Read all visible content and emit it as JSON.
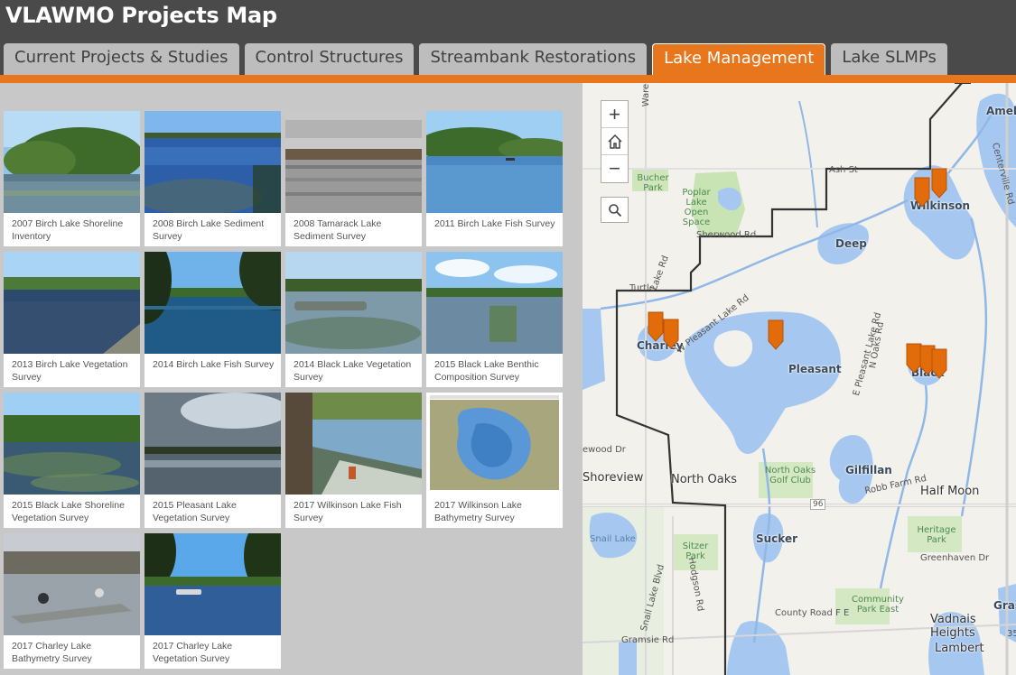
{
  "app": {
    "title": "VLAWMO Projects Map"
  },
  "tabs": [
    {
      "label": "Current Projects & Studies",
      "active": false
    },
    {
      "label": "Control Structures",
      "active": false
    },
    {
      "label": "Streambank Restorations",
      "active": false
    },
    {
      "label": "Lake Management",
      "active": true
    },
    {
      "label": "Lake SLMPs",
      "active": false
    }
  ],
  "colors": {
    "accent": "#e8761c",
    "header": "#4a4a4a",
    "lake": "#a6c8f0",
    "pin": "#e36c0a"
  },
  "gallery": {
    "items": [
      {
        "caption": "2007 Birch Lake Shoreline Inventory"
      },
      {
        "caption": "2008 Birch Lake Sediment Survey"
      },
      {
        "caption": "2008 Tamarack Lake Sediment Survey"
      },
      {
        "caption": "2011 Birch Lake Fish Survey"
      },
      {
        "caption": "2013 Birch Lake Vegetation Survey"
      },
      {
        "caption": "2014 Birch Lake Fish Survey"
      },
      {
        "caption": "2014 Black Lake Vegetation Survey"
      },
      {
        "caption": "2015 Black Lake Benthic Composition Survey"
      },
      {
        "caption": "2015 Black Lake Shoreline Vegetation Survey"
      },
      {
        "caption": "2015 Pleasant Lake Vegetation Survey"
      },
      {
        "caption": "2017 Wilkinson Lake Fish Survey"
      },
      {
        "caption": "2017 Wilkinson Lake Bathymetry Survey"
      },
      {
        "caption": "2017 Charley Lake Bathymetry Survey"
      },
      {
        "caption": "2017 Charley Lake Vegetation Survey"
      }
    ]
  },
  "map": {
    "controls": {
      "zoom_in": "+",
      "home_icon": "home-icon",
      "zoom_out": "−",
      "search_icon": "search-icon"
    },
    "lakes": {
      "amelia": "Amel",
      "wilkinson": "Wilkinson",
      "deep": "Deep",
      "charley": "Charley",
      "pleasant": "Pleasant",
      "black": "Black",
      "gilfillan": "Gilfillan",
      "sucker": "Sucker",
      "snail": "Snail Lake",
      "grass": "Gras"
    },
    "towns": {
      "north_oaks": "North Oaks",
      "half_moon": "Half Moon",
      "shoreview": "Shoreview",
      "vadnais": "Vadnais Heights",
      "lambert": "Lambert"
    },
    "roads": {
      "ash": "Ash St",
      "sherwood": "Sherwood Rd",
      "turtle": "Turtle",
      "pleasant_lake_rd": "W Pleasant Lake Rd",
      "e_pleasant_lake_rd": "E Pleasant Lake Rd",
      "n_oaks_rd": "N Oaks Rd",
      "centerville": "Centerville Rd",
      "robb_farm": "Robb Farm Rd",
      "highway": "96",
      "greenhaven": "Greenhaven Dr",
      "county_f": "County Road F E",
      "gramsie": "Gramsie Rd",
      "snail_lake_blvd": "Snail Lake Blvd",
      "hodgson": "Hodgson Rd",
      "lake_rd": "Lake Rd",
      "wood_dr": "ewood Dr",
      "ware": "Ware",
      "hwy35": "35"
    },
    "parks": {
      "bucher": "Bucher Park",
      "poplar": "Poplar Lake Open Space",
      "golf": "North Oaks Golf Club",
      "heritage": "Heritage Park",
      "sitzer": "Sitzer Park",
      "community": "Community Park East"
    }
  }
}
